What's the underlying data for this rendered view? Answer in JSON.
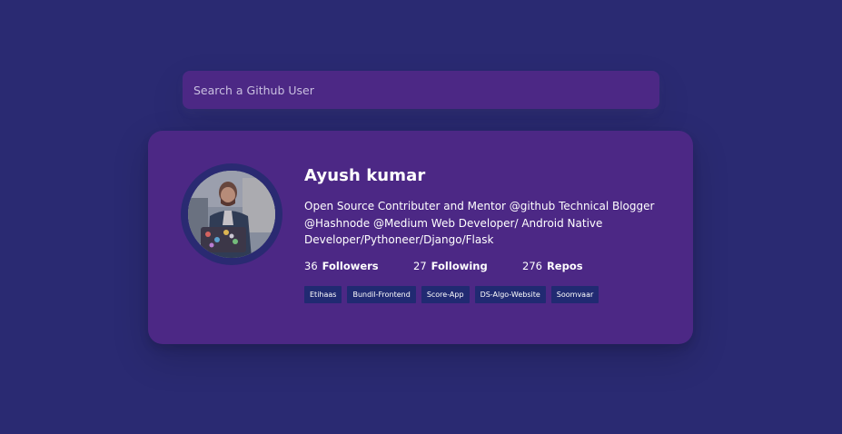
{
  "search": {
    "placeholder": "Search a Github User"
  },
  "profile": {
    "name": "Ayush kumar",
    "bio": "Open Source Contributer and Mentor @github Technical Blogger @Hashnode @Medium Web Developer/ Android Native Developer/Pythoneer/Django/Flask",
    "stats": [
      {
        "value": "36",
        "label": "Followers"
      },
      {
        "value": "27",
        "label": "Following"
      },
      {
        "value": "276",
        "label": "Repos"
      }
    ],
    "repos": [
      "Etihaas",
      "Bundil-Frontend",
      "Score-App",
      "DS-Algo-Website",
      "Soomvaar"
    ]
  },
  "colors": {
    "background": "#2a2a72",
    "card": "#4c2885",
    "repo_tag": "#212a72",
    "text": "#ffffff"
  }
}
